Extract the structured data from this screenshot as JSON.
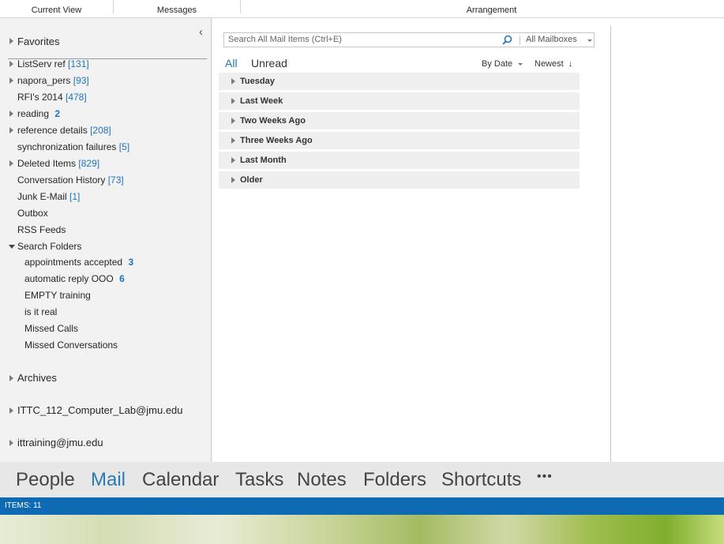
{
  "ribbon": {
    "groups": [
      "Current View",
      "Messages",
      "Arrangement"
    ]
  },
  "folder_pane": {
    "collapse_glyph": "‹",
    "favorites": "Favorites",
    "folders": [
      {
        "name": "ListServ ref",
        "count": "[131]"
      },
      {
        "name": "napora_pers",
        "count": "[93]"
      },
      {
        "name": "RFI's 2014",
        "count": "[478]"
      },
      {
        "name": "reading",
        "count": "2"
      },
      {
        "name": "reference details",
        "count": "[208]"
      },
      {
        "name": "synchronization failures",
        "count": "[5]"
      },
      {
        "name": "Deleted Items",
        "count": "[829]"
      },
      {
        "name": "Conversation History",
        "count": "[73]"
      },
      {
        "name": "Junk E-Mail",
        "count": "[1]"
      },
      {
        "name": "Outbox",
        "count": ""
      },
      {
        "name": "RSS Feeds",
        "count": ""
      },
      {
        "name": "Search Folders",
        "count": ""
      }
    ],
    "search_folders": [
      {
        "name": "appointments accepted",
        "count": "3"
      },
      {
        "name": "automatic reply OOO",
        "count": "6"
      },
      {
        "name": "EMPTY training",
        "count": ""
      },
      {
        "name": "is it real",
        "count": ""
      },
      {
        "name": "Missed Calls",
        "count": ""
      },
      {
        "name": "Missed Conversations",
        "count": ""
      }
    ],
    "archives": "Archives",
    "accounts": [
      "ITTC_112_Computer_Lab@jmu.edu",
      "ittraining@jmu.edu"
    ]
  },
  "search": {
    "placeholder": "Search All Mail Items (Ctrl+E)",
    "scope": "All Mailboxes"
  },
  "filters": {
    "all": "All",
    "unread": "Unread",
    "sort_by": "By Date",
    "order": "Newest"
  },
  "groups": [
    "Tuesday",
    "Last Week",
    "Two Weeks Ago",
    "Three Weeks Ago",
    "Last Month",
    "Older"
  ],
  "nav": {
    "items": [
      "People",
      "Mail",
      "Calendar",
      "Tasks",
      "Notes",
      "Folders",
      "Shortcuts"
    ],
    "more": "•••"
  },
  "status": {
    "items": "ITEMS: 11"
  },
  "colors": {
    "accent": "#1e73be",
    "status_bar": "#0e6ab3",
    "nav_active": "#2a7ab9"
  }
}
